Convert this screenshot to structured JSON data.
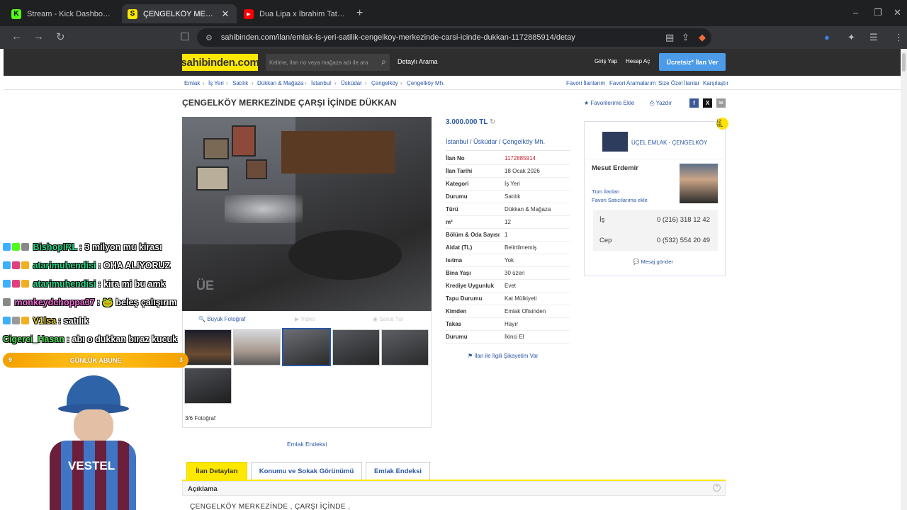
{
  "browser": {
    "tabs": [
      {
        "title": "Stream - Kick Dashboard",
        "fav": "K",
        "favcolor": "#53fc18"
      },
      {
        "title": "ÇENGELKÖY MERKEZİNDE ÇA",
        "fav": "S",
        "favcolor": "#ffe800",
        "active": true,
        "close": "✕"
      },
      {
        "title": "Dua Lipa x İbrahim Tatlıses - Dom Do",
        "fav": "▶",
        "favcolor": "#ff0000"
      }
    ],
    "url": "sahibinden.com/ilan/emlak-is-yeri-satilik-cengelkoy-merkezinde-carsi-icinde-dukkan-1172885914/detay"
  },
  "header": {
    "logo": "sahibinden.com",
    "search_placeholder": "Kelime, ilan no veya mağaza adı ile ara",
    "detailed_search": "Detaylı Arama",
    "login": "Giriş Yap",
    "register": "Hesap Aç",
    "post_ad": "Ücretsiz* İlan Ver"
  },
  "breadcrumb": [
    "Emlak",
    "İş Yeri",
    "Satılık",
    "Dükkan & Mağaza",
    "İstanbul",
    "Üsküdar",
    "Çengelköy",
    "Çengelköy Mh."
  ],
  "toplinks": [
    "Favori İlanlarım",
    "Favori Aramalarım",
    "Size Özel İlanlar",
    "Karşılaştır"
  ],
  "listing": {
    "title": "ÇENGELKÖY MERKEZİNDE ÇARŞI İÇİNDE DÜKKAN",
    "favorite": "Favorilerime Ekle",
    "print": "Yazdır",
    "price": "3.000.000 TL",
    "location": "İstanbul  /  Üsküdar  /  Çengelköy Mh.",
    "photo_tools": [
      "Büyük Fotoğraf",
      "Video",
      "Sanal Tur"
    ],
    "photo_count": "3/6 Fotoğraf",
    "complaint": "İlan ile İlgili Şikayetim Var",
    "emlak_endeksi": "Emlak Endeksi",
    "details": [
      {
        "k": "İlan No",
        "v": "1172885914"
      },
      {
        "k": "İlan Tarihi",
        "v": "18 Ocak 2026"
      },
      {
        "k": "Kategori",
        "v": "İş Yeri"
      },
      {
        "k": "Durumu",
        "v": "Satılık"
      },
      {
        "k": "Türü",
        "v": "Dükkan & Mağaza"
      },
      {
        "k": "m²",
        "v": "12"
      },
      {
        "k": "Bölüm & Oda Sayısı",
        "v": "1"
      },
      {
        "k": "Aidat (TL)",
        "v": "Belirtilmemiş"
      },
      {
        "k": "Isıtma",
        "v": "Yok"
      },
      {
        "k": "Bina Yaşı",
        "v": "30 üzeri"
      },
      {
        "k": "Krediye Uygunluk",
        "v": "Evet"
      },
      {
        "k": "Tapu Durumu",
        "v": "Kat Mülkiyeti"
      },
      {
        "k": "Kimden",
        "v": "Emlak Ofisinden"
      },
      {
        "k": "Takas",
        "v": "Hayır"
      },
      {
        "k": "Durumu",
        "v": "İkinci El"
      }
    ]
  },
  "seller": {
    "store": "ÜÇEL EMLAK - ÇENGELKÖY",
    "person": "Mesut Erdemir",
    "all_ads": "Tüm İlanları",
    "fav_seller": "Favori Satıcılarıma ekle",
    "phones": [
      {
        "label": "İş",
        "number": "0 (216) 318 12 42"
      },
      {
        "label": "Cep",
        "number": "0 (532) 554 20 49"
      }
    ],
    "message": "Mesaj gönder",
    "badge": "12 YIL"
  },
  "detail_tabs": [
    "İlan Detayları",
    "Konumu ve Sokak Görünümü",
    "Emlak Endeksi"
  ],
  "description": {
    "heading": "Açıklama",
    "text": "ÇENGELKÖY  MERKEZİNDE , ÇARŞI  İÇİNDE ,"
  },
  "stream": {
    "chat": [
      {
        "user": "BishopIRL",
        "msg": ": 3 milyon mu kirası",
        "color": "#2ad68a"
      },
      {
        "user": "atarimuhendisi",
        "msg": ": OHA ALIYORUZ",
        "color": "#2ad68a"
      },
      {
        "user": "atarimuhendisi",
        "msg": ": kira mi bu amk",
        "color": "#2ad68a"
      },
      {
        "user": "monkeydchoppa37",
        "msg": ":  🐸  beleş çalışırım",
        "color": "#f06ad4"
      },
      {
        "user": "V1lsa",
        "msg": ": satılık",
        "color": "#e8d43c"
      },
      {
        "user": "Cigerci_Hasan",
        "msg": ": abı o dukkan bıraz kucuk",
        "color": "#55e05a"
      }
    ],
    "sub_bar": "GÜNLÜK ABUNE",
    "sub_left": "9",
    "sub_right": "3",
    "sponsor": "VESTEL"
  },
  "colors": {
    "brand_yellow": "#ffe800",
    "link_blue": "#2a57a6",
    "cta_blue": "#4c9be8"
  }
}
